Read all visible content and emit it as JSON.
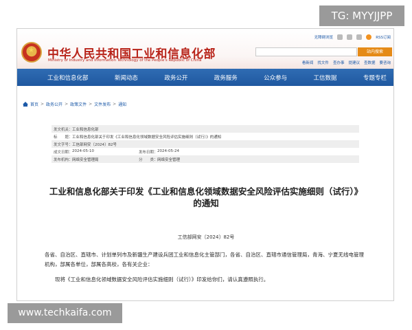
{
  "overlays": {
    "tg_badge": "TG: MYYJJPP",
    "site_badge": "www.techkaifa.com"
  },
  "header": {
    "site_title": "中华人民共和国工业和信息化部",
    "site_subtitle": "Ministry of Industry and Information Technology of the People's Republic of China",
    "top_links": [
      "无障碍浏览",
      "",
      "",
      "",
      "RSS订阅"
    ],
    "search_placeholder": "",
    "search_button": "站内搜索",
    "quick_links": [
      "看新闻",
      "找文件",
      "查办事",
      "提建议",
      "查数据",
      "要咨询"
    ]
  },
  "nav": [
    "工业和信息化部",
    "新闻动态",
    "政务公开",
    "政务服务",
    "公众参与",
    "工信数据",
    "专题专栏"
  ],
  "breadcrumb": [
    "首页",
    "政务公开",
    "政策文件",
    "文件发布",
    "通知"
  ],
  "meta": {
    "issuer_key": "发文机关：",
    "issuer": "工业和信息化部",
    "title_key": "标　　题：",
    "title": "工业和信息化部关于印发《工业和信息化领域数据安全风险评估实施细则（试行）》的通知",
    "docno_key": "发文字号：",
    "docno": "工信部网安〔2024〕82号",
    "created_key": "成文日期：",
    "created": "2024-05-10",
    "published_key": "发布日期：",
    "published": "2024-05-24",
    "org_key": "发布机构：",
    "org": "网络安全管理局",
    "category_key": "分　　类：",
    "category": "网络安全管理"
  },
  "document": {
    "title_line1": "工业和信息化部关于印发《工业和信息化领域数据安全风险评估实施细则（试行）》",
    "title_line2": "的通知",
    "number": "工信部网安〔2024〕82号",
    "recipients": "各省、自治区、直辖市、计划单列市及新疆生产建设兵团工业和信息化主管部门，各省、自治区、直辖市通信管理局，青海、宁夏无线电管理机构，部属各单位，部属各高校，各有关企业：",
    "body": "现将《工业和信息化领域数据安全风险评估实施细则（试行）》印发给你们，请认真遵照执行。"
  },
  "colors": {
    "brand_red": "#b8241a",
    "nav_blue": "#1f58a0",
    "link_blue": "#1d5aa8",
    "search_orange": "#e58a17"
  },
  "icons": [
    "national-emblem-icon",
    "home-icon",
    "rss-icon"
  ]
}
